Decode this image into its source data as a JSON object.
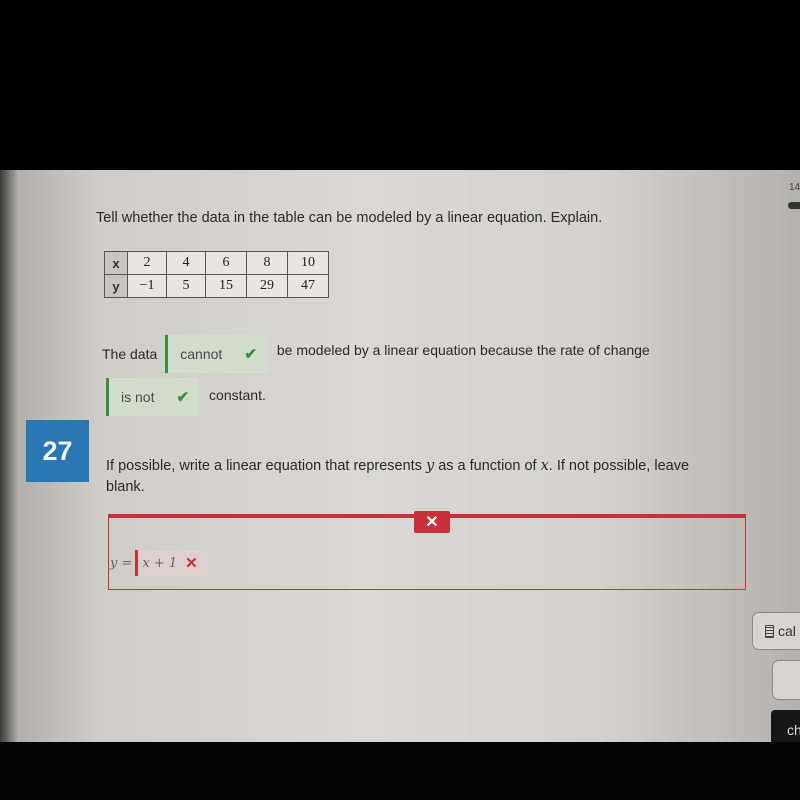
{
  "header": {
    "page_indicator": "14"
  },
  "question_26": {
    "prompt": "Tell whether the data in the table can be modeled by a linear equation. Explain.",
    "table": {
      "rows": [
        {
          "label": "x",
          "values": [
            "2",
            "4",
            "6",
            "8",
            "10"
          ]
        },
        {
          "label": "y",
          "values": [
            "−1",
            "5",
            "15",
            "29",
            "47"
          ]
        }
      ]
    },
    "sentence_1": {
      "before": "The data",
      "answer": "cannot",
      "after": "be modeled by a linear equation because the rate of change"
    },
    "sentence_2": {
      "answer": "is not",
      "after": "constant."
    },
    "answer_status": "correct",
    "check_icon": "✔"
  },
  "question_27": {
    "number": "27",
    "prompt_part1": "If possible, write a linear equation that represents ",
    "var_y": "y",
    "prompt_part2": " as a function of ",
    "var_x": "x",
    "prompt_part3": ". If not possible, leave blank.",
    "equation_prefix": "y =",
    "answer": "x + 1",
    "answer_status": "incorrect",
    "wrong_icon": "✕"
  },
  "side_panel": {
    "calculator_label": "cal",
    "check_label": "ch"
  },
  "colors": {
    "correct": "#3c8a3e",
    "incorrect": "#c9303a",
    "question_badge": "#2b77b4"
  }
}
